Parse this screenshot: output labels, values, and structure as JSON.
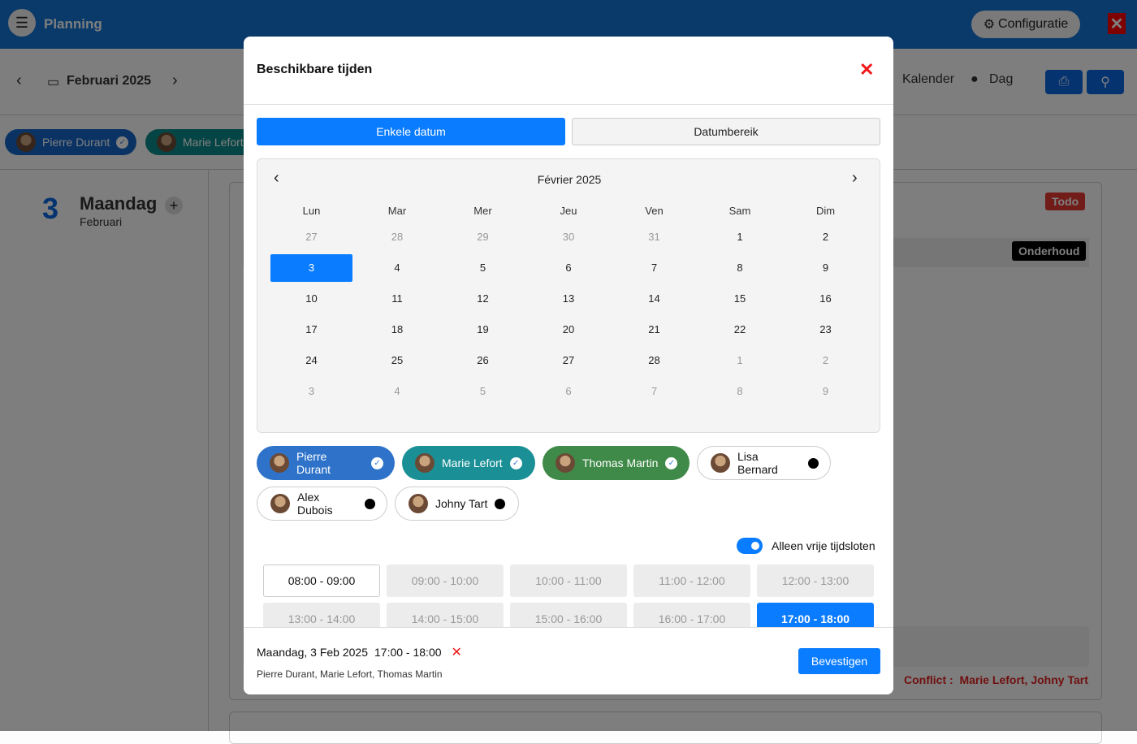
{
  "app": {
    "menu_icon": "hamburger-icon",
    "title": "Planning",
    "config_label": "Configuratie",
    "close_label": "✕"
  },
  "nav": {
    "month": "Februari 2025",
    "view_calendar": "Kalender",
    "view_day": "Dag"
  },
  "bg_chips": [
    {
      "name": "Pierre Durant",
      "color": "#1566c8"
    },
    {
      "name": "Marie Lefort",
      "color": "#0d8a8a"
    }
  ],
  "day_header": {
    "number": "3",
    "weekday": "Maandag",
    "month": "Februari"
  },
  "bg_card": {
    "badge_todo": "Todo",
    "badge_type": "Onderhoud",
    "conflict_label": "Conflict :",
    "conflict_names": "Marie Lefort, Johny Tart"
  },
  "modal": {
    "title": "Beschikbare tijden",
    "tabs": {
      "single": "Enkele datum",
      "range": "Datumbereik"
    },
    "calendar": {
      "title": "Février 2025",
      "weekdays": [
        "Lun",
        "Mar",
        "Mer",
        "Jeu",
        "Ven",
        "Sam",
        "Dim"
      ],
      "weeks": [
        [
          "27",
          "28",
          "29",
          "30",
          "31",
          "1",
          "2"
        ],
        [
          "3",
          "4",
          "5",
          "6",
          "7",
          "8",
          "9"
        ],
        [
          "10",
          "11",
          "12",
          "13",
          "14",
          "15",
          "16"
        ],
        [
          "17",
          "18",
          "19",
          "20",
          "21",
          "22",
          "23"
        ],
        [
          "24",
          "25",
          "26",
          "27",
          "28",
          "1",
          "2"
        ],
        [
          "3",
          "4",
          "5",
          "6",
          "7",
          "8",
          "9"
        ]
      ],
      "selected": "3"
    },
    "people": [
      {
        "name": "Pierre Durant",
        "selected": true,
        "color": "#2e73c9"
      },
      {
        "name": "Marie Lefort",
        "selected": true,
        "color": "#1a9096"
      },
      {
        "name": "Thomas Martin",
        "selected": true,
        "color": "#3f8a48"
      },
      {
        "name": "Lisa Bernard",
        "selected": false
      },
      {
        "name": "Alex Dubois",
        "selected": false
      },
      {
        "name": "Johny Tart",
        "selected": false
      }
    ],
    "toggle": {
      "label": "Alleen vrije tijdsloten",
      "on": true
    },
    "slots": [
      {
        "label": "08:00 - 09:00",
        "state": "free"
      },
      {
        "label": "09:00 - 10:00",
        "state": "busy"
      },
      {
        "label": "10:00 - 11:00",
        "state": "busy"
      },
      {
        "label": "11:00 - 12:00",
        "state": "busy"
      },
      {
        "label": "12:00 - 13:00",
        "state": "busy"
      },
      {
        "label": "13:00 - 14:00",
        "state": "busy"
      },
      {
        "label": "14:00 - 15:00",
        "state": "busy"
      },
      {
        "label": "15:00 - 16:00",
        "state": "busy"
      },
      {
        "label": "16:00 - 17:00",
        "state": "busy"
      },
      {
        "label": "17:00 - 18:00",
        "state": "selected"
      }
    ],
    "summary": {
      "date": "Maandag, 3 Feb 2025",
      "time": "17:00 - 18:00",
      "people": "Pierre Durant, Marie Lefort, Thomas Martin"
    },
    "confirm": "Bevestigen"
  }
}
